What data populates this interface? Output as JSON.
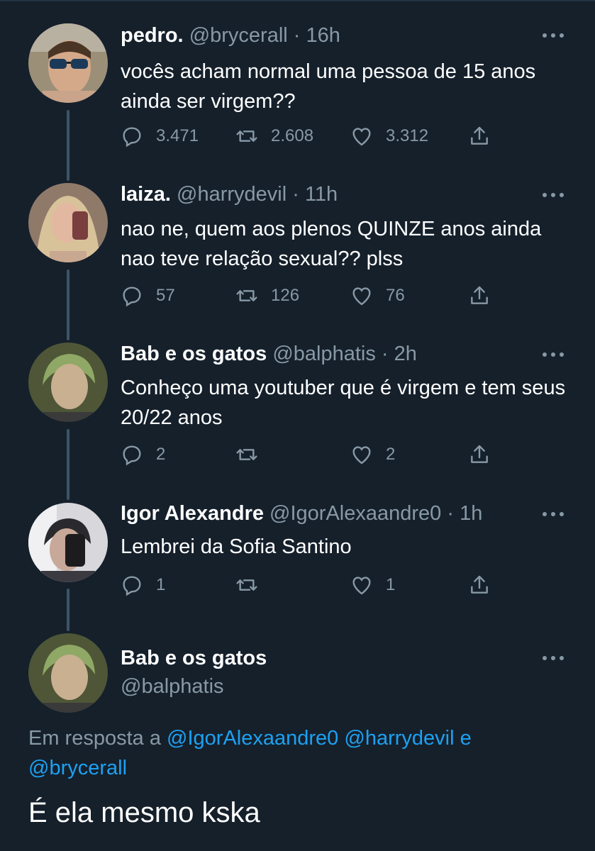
{
  "tweets": [
    {
      "name": "pedro.",
      "handle": "@brycerall",
      "time": "16h",
      "text": "vocês acham normal uma pessoa de 15 anos ainda ser virgem??",
      "replies": "3.471",
      "retweets": "2.608",
      "likes": "3.312",
      "avatar_color": "#8a7f6c"
    },
    {
      "name": "laiza.",
      "handle": "@harrydevil",
      "time": "11h",
      "text": "nao ne, quem aos plenos QUINZE anos ainda nao teve relação sexual?? plss",
      "replies": "57",
      "retweets": "126",
      "likes": "76",
      "avatar_color": "#b59a83"
    },
    {
      "name": "Bab e os gatos",
      "handle": "@balphatis",
      "time": "2h",
      "text": "Conheço uma youtuber que é virgem e tem seus 20/22 anos",
      "replies": "2",
      "retweets": "",
      "likes": "2",
      "avatar_color": "#56603f"
    },
    {
      "name": "Igor Alexandre",
      "handle": "@IgorAlexaandre0",
      "time": "1h",
      "text": "Lembrei da Sofia Santino",
      "replies": "1",
      "retweets": "",
      "likes": "1",
      "avatar_color": "#6b6a70"
    }
  ],
  "main_tweet": {
    "name": "Bab e os gatos",
    "handle": "@balphatis",
    "reply_prefix": "Em resposta a",
    "mention_1": "@IgorAlexaandre0",
    "mention_2": "@harrydevil",
    "conjunction": "e",
    "mention_3": "@brycerall",
    "text": "É ela mesmo kska",
    "avatar_color": "#56603f"
  },
  "header_separator": "·",
  "colors": {
    "background": "#15202b",
    "secondary_text": "#8899a6",
    "link": "#1da1f2",
    "thread_line": "#3d5466"
  },
  "icons": [
    "reply-icon",
    "retweet-icon",
    "like-icon",
    "share-icon",
    "more-icon"
  ]
}
